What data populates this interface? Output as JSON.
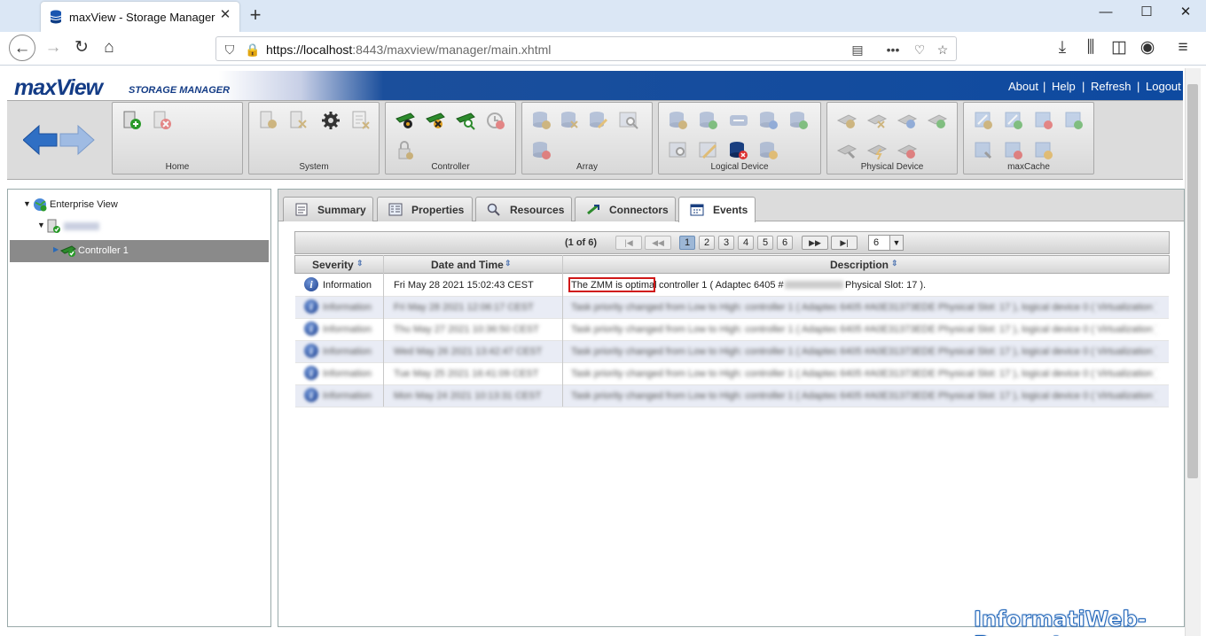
{
  "browser": {
    "tab_title": "maxView - Storage Manager",
    "url_host": "https://localhost",
    "url_path": ":8443/maxview/manager/main.xhtml"
  },
  "header": {
    "logo_main": "maxView",
    "logo_sub": "STORAGE MANAGER",
    "links": [
      "About",
      "Help",
      "Refresh",
      "Logout"
    ]
  },
  "toolbar": {
    "groups": [
      "Home",
      "System",
      "Controller",
      "Array",
      "Logical Device",
      "Physical Device",
      "maxCache"
    ]
  },
  "tree": {
    "root": "Enterprise View",
    "controller": "Controller 1"
  },
  "tabs": [
    "Summary",
    "Properties",
    "Resources",
    "Connectors",
    "Events"
  ],
  "active_tab": "Events",
  "pager": {
    "label": "(1 of 6)",
    "pages": [
      "1",
      "2",
      "3",
      "4",
      "5",
      "6"
    ],
    "current": "1",
    "page_select": "6"
  },
  "grid": {
    "columns": [
      "Severity",
      "Date and Time",
      "Description"
    ],
    "rows": [
      {
        "severity": "Information",
        "datetime": "Fri May 28 2021 15:02:43 CEST",
        "desc_highlight": "The ZMM is optimal",
        "desc_rest": "controller 1 ( Adaptec 6405 #",
        "desc_tail": "Physical Slot: 17 )."
      },
      {
        "severity": "Information",
        "datetime": "Fri May 28 2021 12:06:17 CEST",
        "desc": "Task priority changed from Low to High: controller 1 ( Adaptec 6405 #A0E31373EDE Physical Slot: 17 ), logical device 0 ( Virtualization )"
      },
      {
        "severity": "Information",
        "datetime": "Thu May 27 2021 10:36:50 CEST",
        "desc": "Task priority changed from Low to High: controller 1 ( Adaptec 6405 #A0E31373EDE Physical Slot: 17 ), logical device 0 ( Virtualization )"
      },
      {
        "severity": "Information",
        "datetime": "Wed May 26 2021 13:42:47 CEST",
        "desc": "Task priority changed from Low to High: controller 1 ( Adaptec 6405 #A0E31373EDE Physical Slot: 17 ), logical device 0 ( Virtualization )"
      },
      {
        "severity": "Information",
        "datetime": "Tue May 25 2021 16:41:09 CEST",
        "desc": "Task priority changed from Low to High: controller 1 ( Adaptec 6405 #A0E31373EDE Physical Slot: 17 ), logical device 0 ( Virtualization )"
      },
      {
        "severity": "Information",
        "datetime": "Mon May 24 2021 10:13:31 CEST",
        "desc": "Task priority changed from Low to High: controller 1 ( Adaptec 6405 #A0E31373EDE Physical Slot: 17 ), logical device 0 ( Virtualization )"
      }
    ]
  },
  "watermark": "InformatiWeb-Pro.net",
  "colors": {
    "banner": "#0e4aa0",
    "highlight_box": "#d01818",
    "selected_row": "#8a8a8a"
  }
}
